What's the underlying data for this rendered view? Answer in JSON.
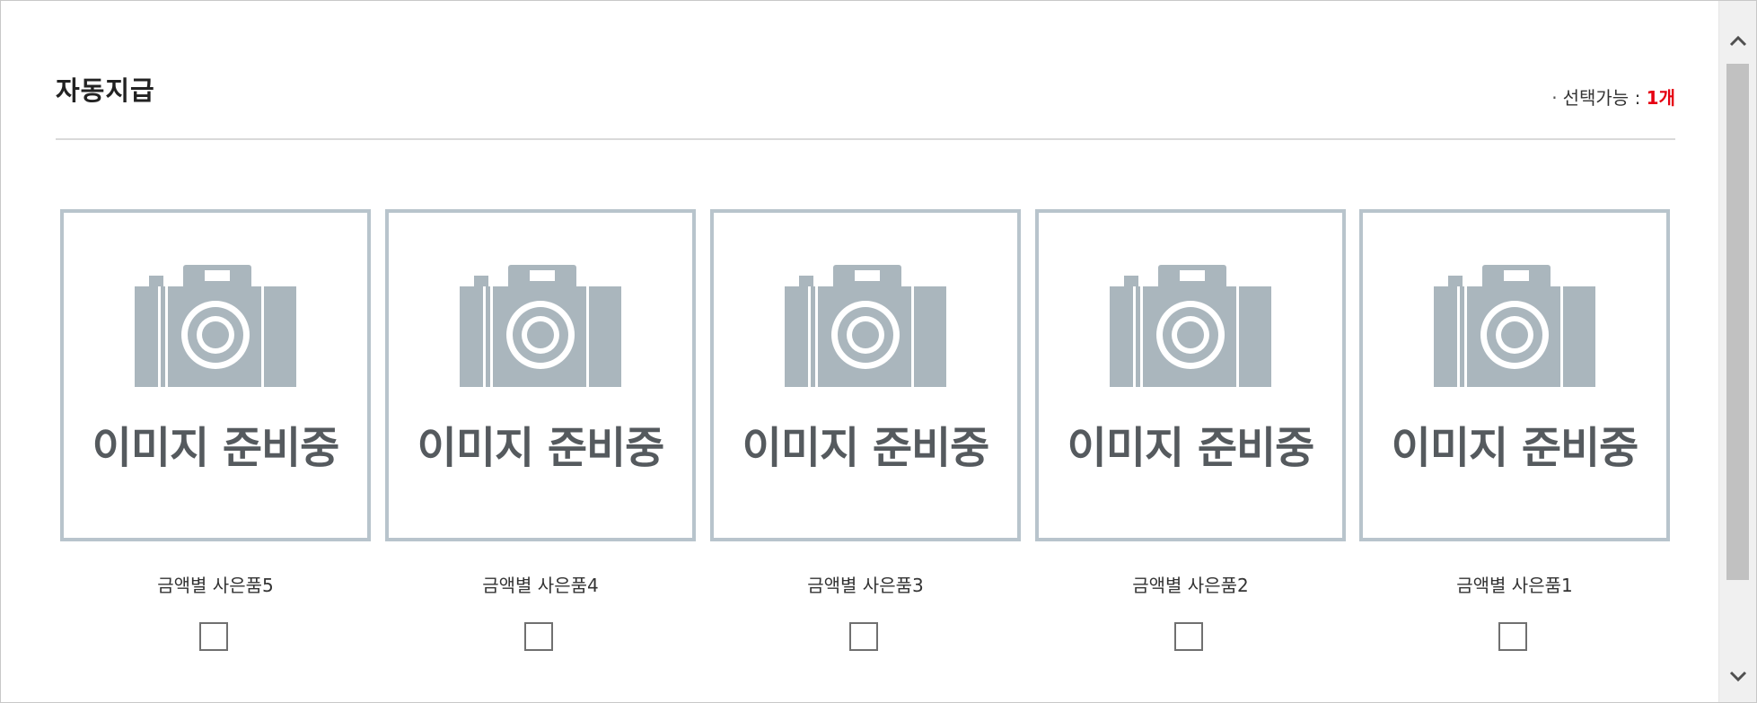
{
  "header": {
    "title": "자동지급",
    "avail_bullet": "·",
    "avail_label": "선택가능 : ",
    "avail_count": "1개"
  },
  "gifts": [
    {
      "placeholder": "이미지 준비중",
      "name": "금액별 사은품5",
      "checked": false
    },
    {
      "placeholder": "이미지 준비중",
      "name": "금액별 사은품4",
      "checked": false
    },
    {
      "placeholder": "이미지 준비중",
      "name": "금액별 사은품3",
      "checked": false
    },
    {
      "placeholder": "이미지 준비중",
      "name": "금액별 사은품2",
      "checked": false
    },
    {
      "placeholder": "이미지 준비중",
      "name": "금액별 사은품1",
      "checked": false
    }
  ],
  "icons": {
    "thumbnail": "camera-icon",
    "scroll_up": "chevron-up-icon",
    "scroll_down": "chevron-down-icon"
  },
  "colors": {
    "accent_count": "#e60012",
    "thumb_border": "#b8c4cc",
    "camera": "#aab6bd"
  }
}
